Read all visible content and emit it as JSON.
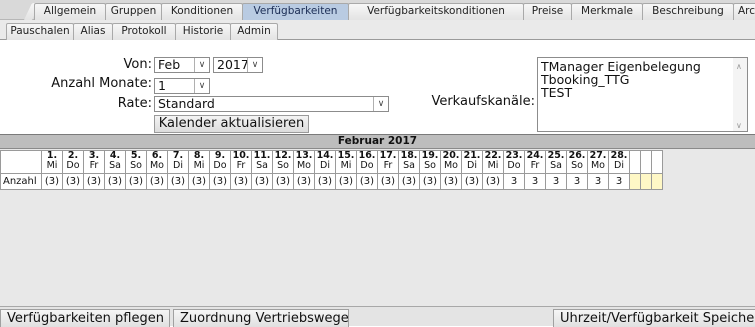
{
  "tabs_top": [
    "Allgemein",
    "Gruppen",
    "Konditionen",
    "Verfügbarkeiten",
    "Verfügbarkeitskonditionen",
    "Preise",
    "Merkmale",
    "Beschreibung",
    "Archiv"
  ],
  "tabs_sub": [
    "Pauschalen",
    "Alias",
    "Protokoll",
    "Historie",
    "Admin"
  ],
  "active_top_tab": "Verfügbarkeiten",
  "form": {
    "von_label": "Von:",
    "von_month": "Feb",
    "von_year": "2017",
    "anzahl_label": "Anzahl Monate:",
    "anzahl_value": "1",
    "rate_label": "Rate:",
    "rate_value": "Standard",
    "refresh_button": "Kalender aktualisieren",
    "channels_label": "Verkaufskanäle:",
    "channels": [
      "TManager Eigenbelegung",
      "Tbooking_TTG",
      "TEST"
    ]
  },
  "calendar": {
    "month_title": "Februar 2017",
    "row_label": "Anzahl",
    "days": [
      {
        "num": "1.",
        "wd": "Mi",
        "val": "(3)"
      },
      {
        "num": "2.",
        "wd": "Do",
        "val": "(3)"
      },
      {
        "num": "3.",
        "wd": "Fr",
        "val": "(3)"
      },
      {
        "num": "4.",
        "wd": "Sa",
        "val": "(3)"
      },
      {
        "num": "5.",
        "wd": "So",
        "val": "(3)"
      },
      {
        "num": "6.",
        "wd": "Mo",
        "val": "(3)"
      },
      {
        "num": "7.",
        "wd": "Di",
        "val": "(3)"
      },
      {
        "num": "8.",
        "wd": "Mi",
        "val": "(3)"
      },
      {
        "num": "9.",
        "wd": "Do",
        "val": "(3)"
      },
      {
        "num": "10.",
        "wd": "Fr",
        "val": "(3)"
      },
      {
        "num": "11.",
        "wd": "Sa",
        "val": "(3)"
      },
      {
        "num": "12.",
        "wd": "So",
        "val": "(3)"
      },
      {
        "num": "13.",
        "wd": "Mo",
        "val": "(3)"
      },
      {
        "num": "14.",
        "wd": "Di",
        "val": "(3)"
      },
      {
        "num": "15.",
        "wd": "Mi",
        "val": "(3)"
      },
      {
        "num": "16.",
        "wd": "Do",
        "val": "(3)"
      },
      {
        "num": "17.",
        "wd": "Fr",
        "val": "(3)"
      },
      {
        "num": "18.",
        "wd": "Sa",
        "val": "(3)"
      },
      {
        "num": "19.",
        "wd": "So",
        "val": "(3)"
      },
      {
        "num": "20.",
        "wd": "Mo",
        "val": "(3)"
      },
      {
        "num": "21.",
        "wd": "Di",
        "val": "(3)"
      },
      {
        "num": "22.",
        "wd": "Mi",
        "val": "(3)"
      },
      {
        "num": "23.",
        "wd": "Do",
        "val": "3"
      },
      {
        "num": "24.",
        "wd": "Fr",
        "val": "3"
      },
      {
        "num": "25.",
        "wd": "Sa",
        "val": "3"
      },
      {
        "num": "26.",
        "wd": "So",
        "val": "3"
      },
      {
        "num": "27.",
        "wd": "Mo",
        "val": "3"
      },
      {
        "num": "28.",
        "wd": "Di",
        "val": "3"
      }
    ]
  },
  "bottom_buttons": [
    "Verfügbarkeiten pflegen",
    "Zuordnung Vertriebswege",
    "Uhrzeit/Verfügbarkeit Speichern"
  ],
  "icons": {
    "dropdown": "chevron-down-icon",
    "scroll_up": "scroll-up-icon",
    "scroll_down": "scroll-down-icon"
  }
}
